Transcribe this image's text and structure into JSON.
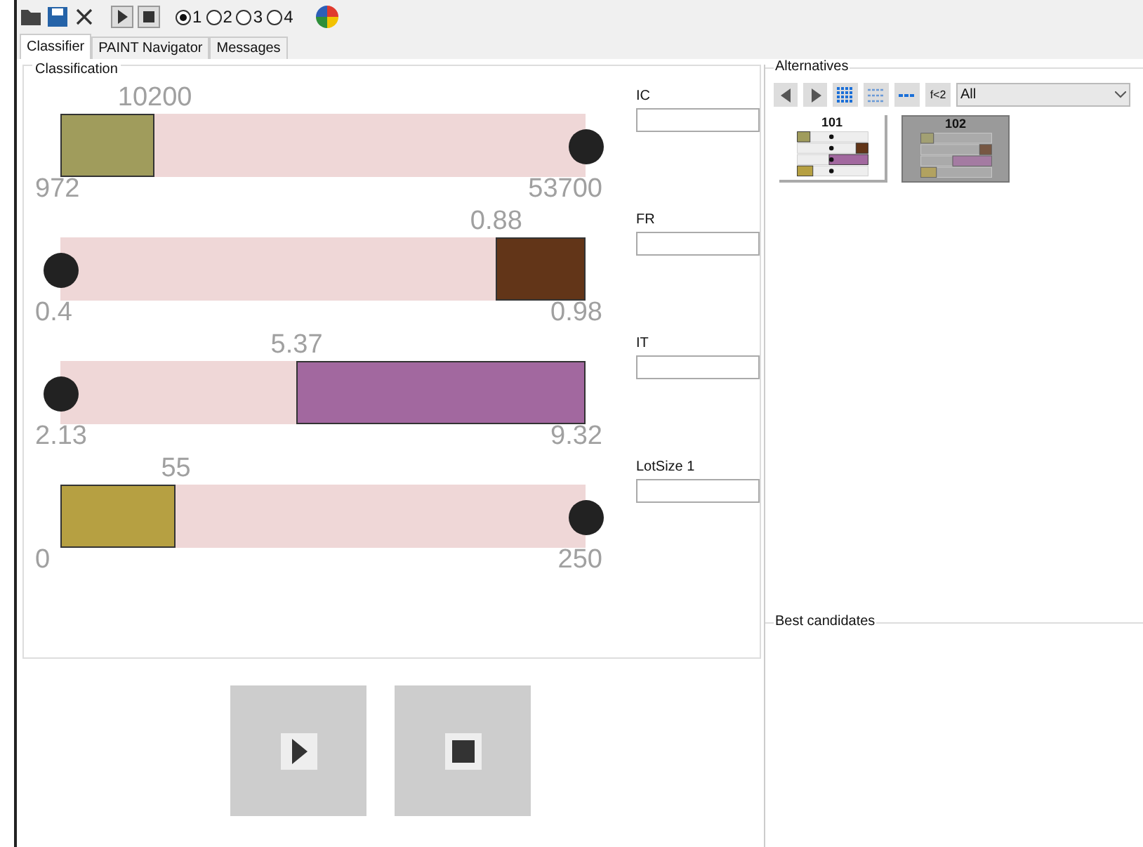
{
  "toolbar": {
    "radios": [
      {
        "label": "1",
        "selected": true
      },
      {
        "label": "2",
        "selected": false
      },
      {
        "label": "3",
        "selected": false
      },
      {
        "label": "4",
        "selected": false
      }
    ]
  },
  "tabs": [
    {
      "label": "Classifier",
      "selected": true
    },
    {
      "label": "PAINT Navigator",
      "selected": false
    },
    {
      "label": "Messages",
      "selected": false
    }
  ],
  "classification": {
    "title": "Classification",
    "criteria": [
      {
        "name": "IC",
        "value": "10200",
        "min": "972",
        "max": "53700",
        "level": 0.18,
        "kind": "left",
        "color": "#a09c5c"
      },
      {
        "name": "FR",
        "value": "0.88",
        "min": "0.4",
        "max": "0.98",
        "level": 0.17,
        "kind": "right",
        "color": "#623518"
      },
      {
        "name": "IT",
        "value": "5.37",
        "min": "2.13",
        "max": "9.32",
        "level": 0.55,
        "kind": "right",
        "color": "#a2689f"
      },
      {
        "name": "LotSize 1",
        "value": "55",
        "min": "0",
        "max": "250",
        "level": 0.22,
        "kind": "left",
        "color": "#b6a042"
      }
    ]
  },
  "alternatives": {
    "title": "Alternatives",
    "filter_button": "f<2",
    "filter": "All",
    "items": [
      {
        "label": "101",
        "selected": false
      },
      {
        "label": "102",
        "selected": true
      }
    ]
  },
  "best_candidates": {
    "title": "Best candidates"
  }
}
